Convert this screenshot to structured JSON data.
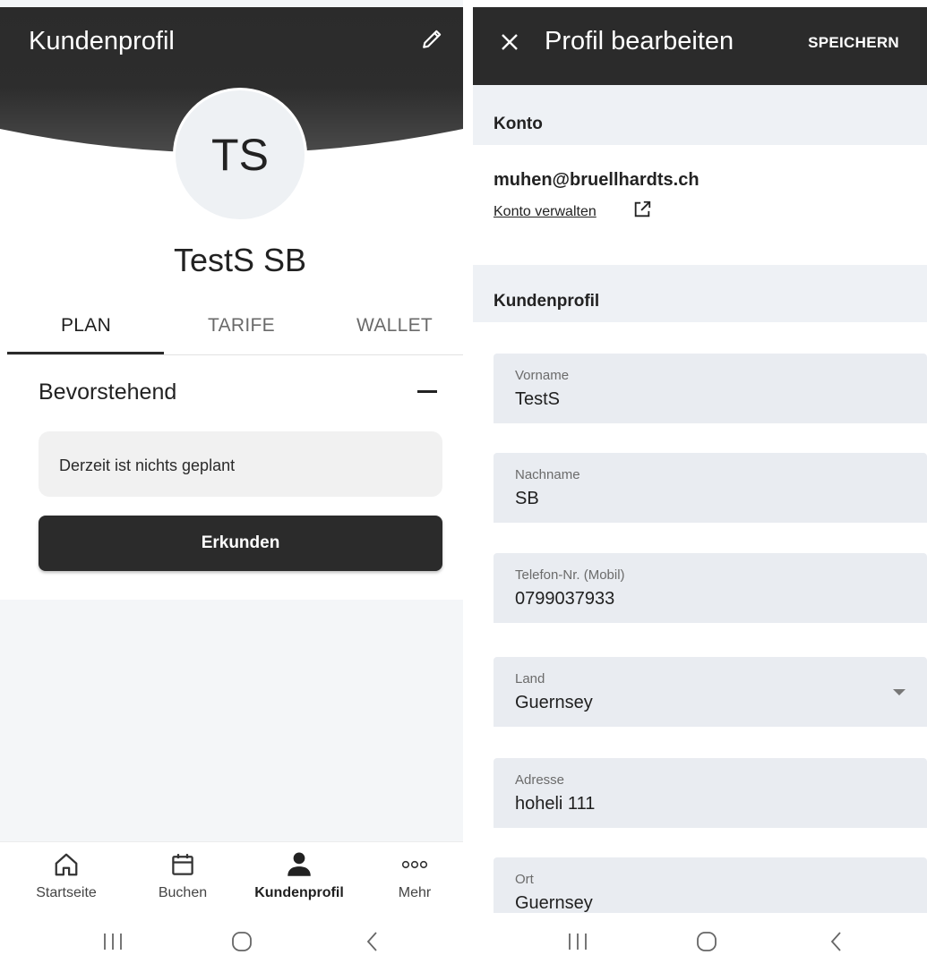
{
  "left": {
    "header": {
      "title": "Kundenprofil",
      "edit_icon": "pencil-icon"
    },
    "avatar_initials": "TS",
    "profile_name": "TestS SB",
    "tabs": [
      {
        "label": "PLAN",
        "active": true
      },
      {
        "label": "TARIFE",
        "active": false
      },
      {
        "label": "WALLET",
        "active": false
      }
    ],
    "upcoming": {
      "title": "Bevorstehend",
      "empty_text": "Derzeit ist nichts geplant",
      "explore_label": "Erkunden"
    },
    "bottom_nav": [
      {
        "label": "Startseite",
        "icon": "home-icon",
        "active": false
      },
      {
        "label": "Buchen",
        "icon": "calendar-icon",
        "active": false
      },
      {
        "label": "Kundenprofil",
        "icon": "person-icon",
        "active": true
      },
      {
        "label": "Mehr",
        "icon": "more-dots-icon",
        "active": false
      }
    ]
  },
  "right": {
    "header": {
      "title": "Profil bearbeiten",
      "save_label": "SPEICHERN",
      "close_icon": "close-icon"
    },
    "account": {
      "section_title": "Konto",
      "email": "muhen@bruellhardts.ch",
      "manage_link": "Konto verwalten"
    },
    "profile": {
      "section_title": "Kundenprofil",
      "fields": [
        {
          "label": "Vorname",
          "value": "TestS"
        },
        {
          "label": "Nachname",
          "value": "SB"
        },
        {
          "label": "Telefon-Nr. (Mobil)",
          "value": "0799037933"
        },
        {
          "label": "Land",
          "value": "Guernsey",
          "type": "select"
        },
        {
          "label": "Adresse",
          "value": "hoheli 111"
        },
        {
          "label": "Ort",
          "value": "Guernsey"
        }
      ]
    }
  },
  "colors": {
    "header_dark": "#2b2b2b",
    "field_bg": "#e9ecf1",
    "section_bg": "#eef1f5"
  }
}
